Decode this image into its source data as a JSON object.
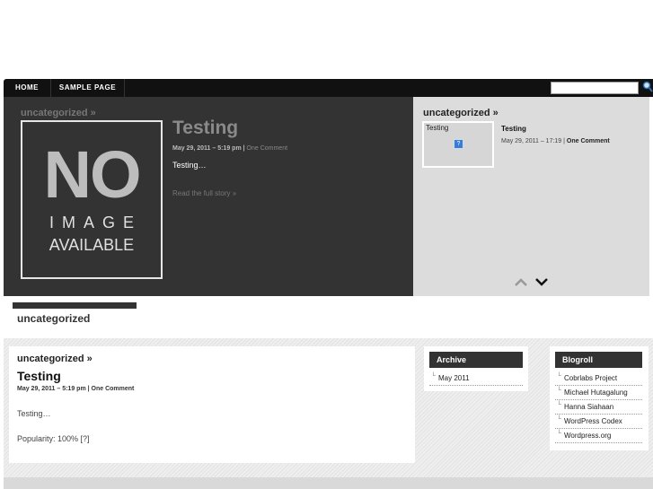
{
  "nav": {
    "items": [
      "HOME",
      "SAMPLE PAGE"
    ]
  },
  "search": {
    "value": ""
  },
  "featured": {
    "category": "uncategorized »",
    "image_text": {
      "line1": "NO",
      "line2": "IMAGE",
      "line3": "AVAILABLE"
    },
    "title": "Testing",
    "meta_date": "May 29, 2011 – 5:19 pm | ",
    "meta_comments": "One Comment",
    "excerpt": "Testing…",
    "read_more": "Read the full story »"
  },
  "slider": {
    "category": "uncategorized »",
    "thumb_label": "Testing",
    "thumb_icon": "?",
    "title": "Testing",
    "meta_date": "May 29, 2011 – 17:19 | ",
    "meta_comments": "One Comment"
  },
  "category_heading": "uncategorized",
  "post": {
    "category": "uncategorized »",
    "title": "Testing",
    "meta_date": "May 29, 2011 – 5:19 pm | ",
    "meta_comments": "One Comment",
    "excerpt": "Testing…",
    "popularity": "Popularity: 100% [?]"
  },
  "archive": {
    "title": "Archive",
    "items": [
      "May 2011"
    ]
  },
  "blogroll": {
    "title": "Blogroll",
    "items": [
      "Cobrlabs Project",
      "Michael Hutagalung",
      "Hanna Siahaan",
      "WordPress Codex",
      "Wordpress.org"
    ]
  }
}
